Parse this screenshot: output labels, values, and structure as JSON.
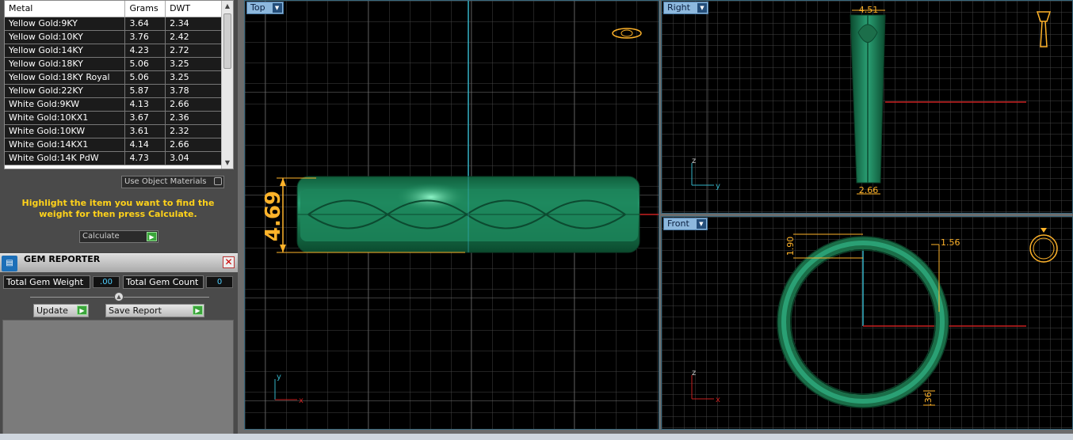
{
  "metal_table": {
    "columns": [
      "Metal",
      "Grams",
      "DWT"
    ],
    "rows": [
      [
        "Yellow Gold:9KY",
        "3.64",
        "2.34"
      ],
      [
        "Yellow Gold:10KY",
        "3.76",
        "2.42"
      ],
      [
        "Yellow Gold:14KY",
        "4.23",
        "2.72"
      ],
      [
        "Yellow Gold:18KY",
        "5.06",
        "3.25"
      ],
      [
        "Yellow Gold:18KY Royal",
        "5.06",
        "3.25"
      ],
      [
        "Yellow Gold:22KY",
        "5.87",
        "3.78"
      ],
      [
        "White Gold:9KW",
        "4.13",
        "2.66"
      ],
      [
        "White Gold:10KX1",
        "3.67",
        "2.36"
      ],
      [
        "White Gold:10KW",
        "3.61",
        "2.32"
      ],
      [
        "White Gold:14KX1",
        "4.14",
        "2.66"
      ],
      [
        "White Gold:14K PdW",
        "4.73",
        "3.04"
      ]
    ]
  },
  "use_object_materials_label": "Use Object Materials",
  "hint_text": "Highlight the item you want to find the weight for then press Calculate.",
  "calculate_label": "Calculate",
  "gem_reporter": {
    "title": "GEM REPORTER",
    "total_gem_weight_label": "Total Gem Weight",
    "total_gem_weight_value": ".00",
    "total_gem_count_label": "Total Gem Count",
    "total_gem_count_value": "0",
    "update_label": "Update",
    "save_report_label": "Save Report"
  },
  "viewports": {
    "top": {
      "label": "Top",
      "dimension": "4.69",
      "axis_v": "y",
      "axis_h": "x"
    },
    "right": {
      "label": "Right",
      "dimension_top": "4.51",
      "dimension_bottom": "2.66",
      "axis_v": "z",
      "axis_h": "y"
    },
    "front": {
      "label": "Front",
      "dimension_left": "1.90",
      "dimension_right": "1.56",
      "dimension_bottom": ".36",
      "axis_v": "z",
      "axis_h": "x"
    }
  },
  "colors": {
    "ring_green": "#1f8a5c",
    "dimension": "#ffb32a",
    "axis_cyan": "#35b4c8",
    "axis_red": "#c82020",
    "hint_yellow": "#ffd21a"
  }
}
